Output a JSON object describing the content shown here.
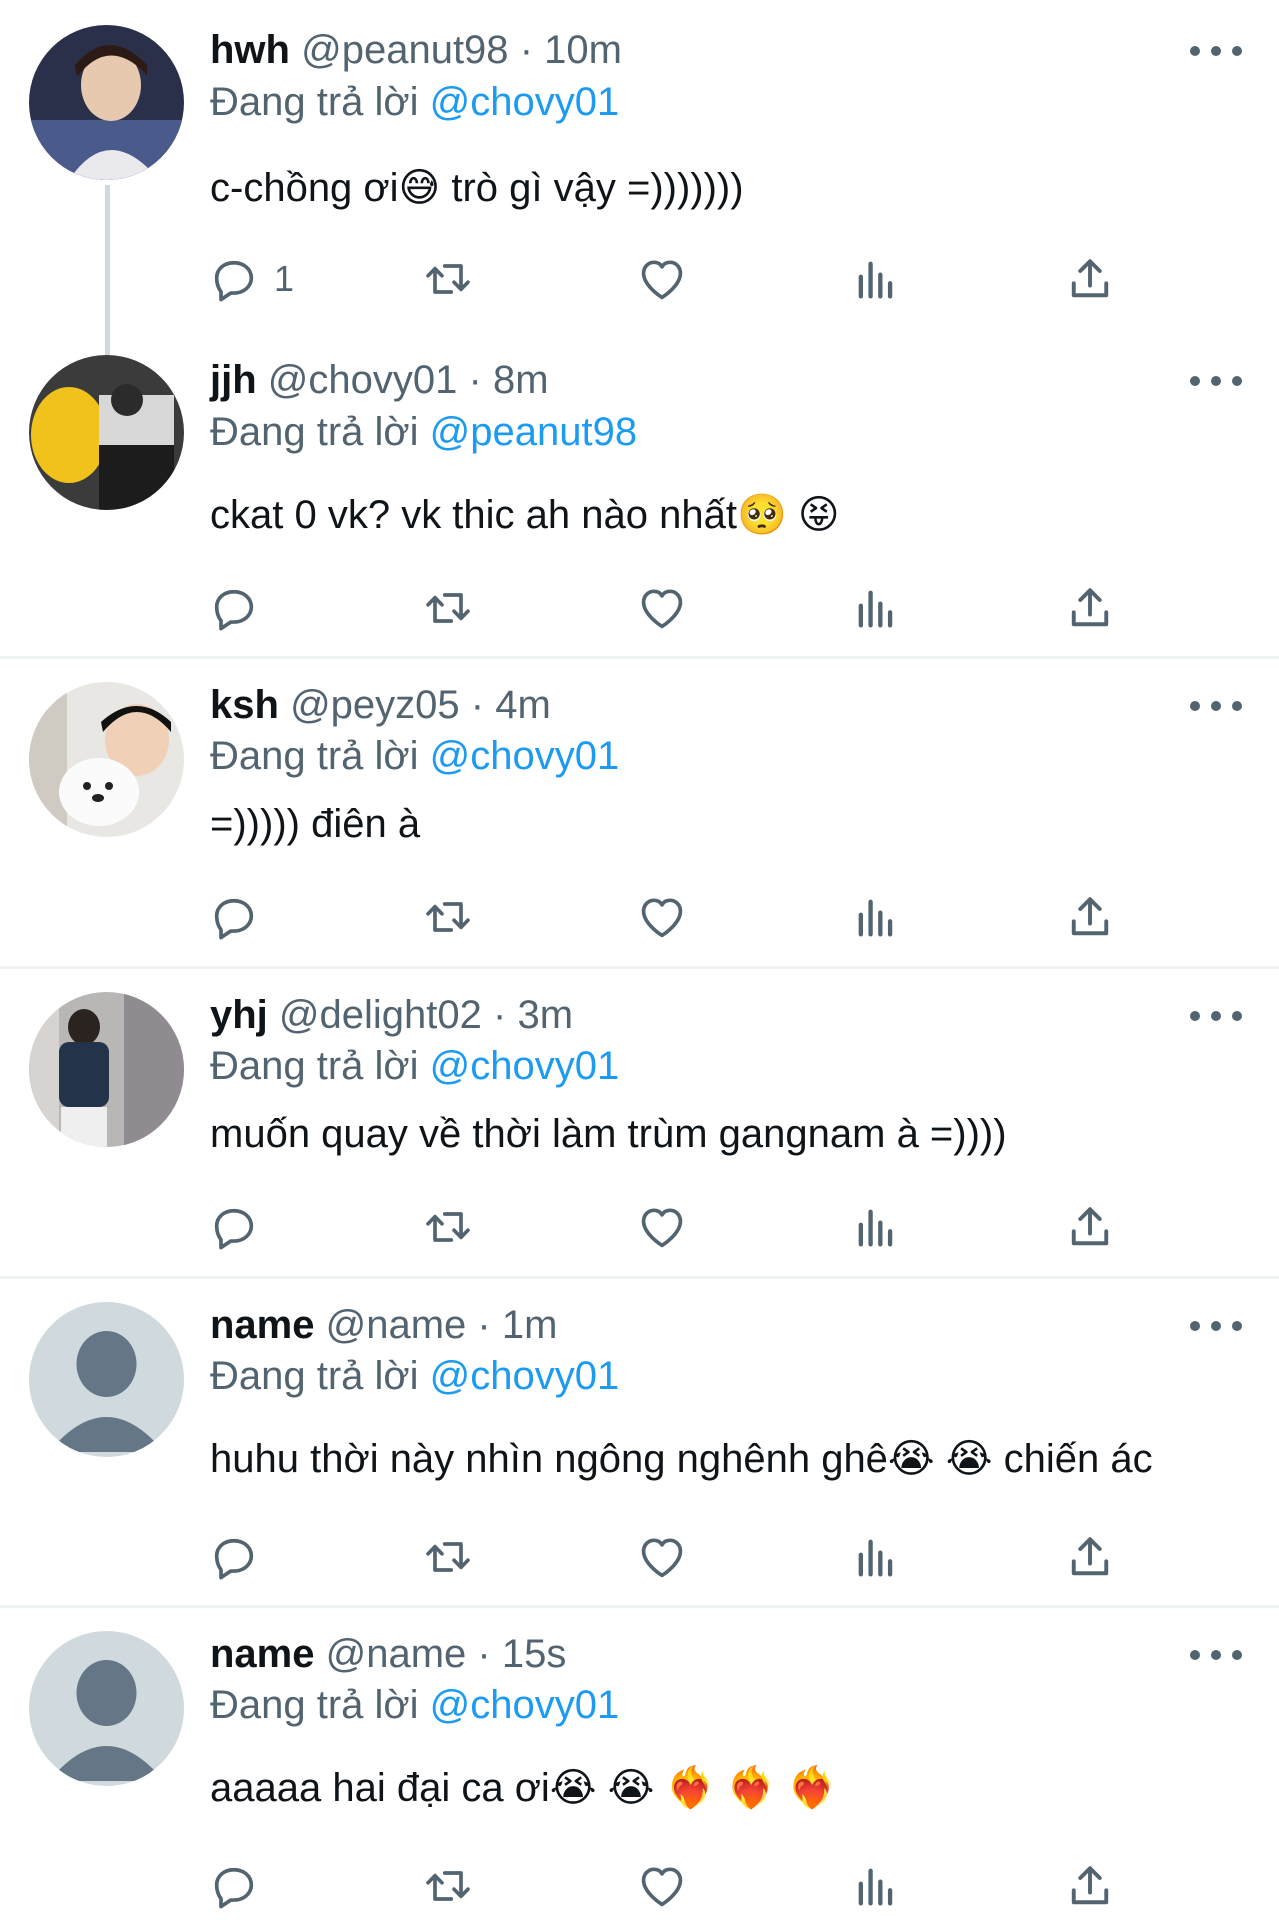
{
  "replying_prefix": "Đang trả lời",
  "colors": {
    "link": "#1d9bf0",
    "secondary": "#536471",
    "text": "#0f1419",
    "divider": "#eff3f4",
    "thread": "#cfd9de"
  },
  "tweets": [
    {
      "name": "hwh",
      "handle": "@peanut98",
      "sep": "·",
      "time": "10m",
      "reply_to": "@chovy01",
      "text": "c-chồng ơi😅  trò gì vậy =)))))))",
      "reply_count": "1"
    },
    {
      "name": "jjh",
      "handle": "@chovy01",
      "sep": "·",
      "time": "8m",
      "reply_to": "@peanut98",
      "text": "ckat 0 vk? vk thic ah nào nhất🥺 😝",
      "reply_count": ""
    },
    {
      "name": "ksh",
      "handle": "@peyz05",
      "sep": "·",
      "time": "4m",
      "reply_to": "@chovy01",
      "text": "=))))) điên à",
      "reply_count": ""
    },
    {
      "name": "yhj",
      "handle": "@delight02",
      "sep": "·",
      "time": "3m",
      "reply_to": "@chovy01",
      "text": "muốn quay về thời làm trùm gangnam à =))))",
      "reply_count": ""
    },
    {
      "name": "name",
      "handle": "@name",
      "sep": "·",
      "time": "1m",
      "reply_to": "@chovy01",
      "text": "huhu thời này nhìn ngông nghênh ghê😭 😭  chiến ác",
      "reply_count": ""
    },
    {
      "name": "name",
      "handle": "@name",
      "sep": "·",
      "time": "15s",
      "reply_to": "@chovy01",
      "text": "aaaaa hai đại ca ơi😭 😭 ❤️‍🔥 ❤️‍🔥 ❤️‍🔥",
      "reply_count": ""
    }
  ],
  "icons": {
    "more": "more-horizontal-icon",
    "reply": "reply-icon",
    "retweet": "retweet-icon",
    "like": "heart-icon",
    "views": "views-icon",
    "share": "share-icon"
  }
}
